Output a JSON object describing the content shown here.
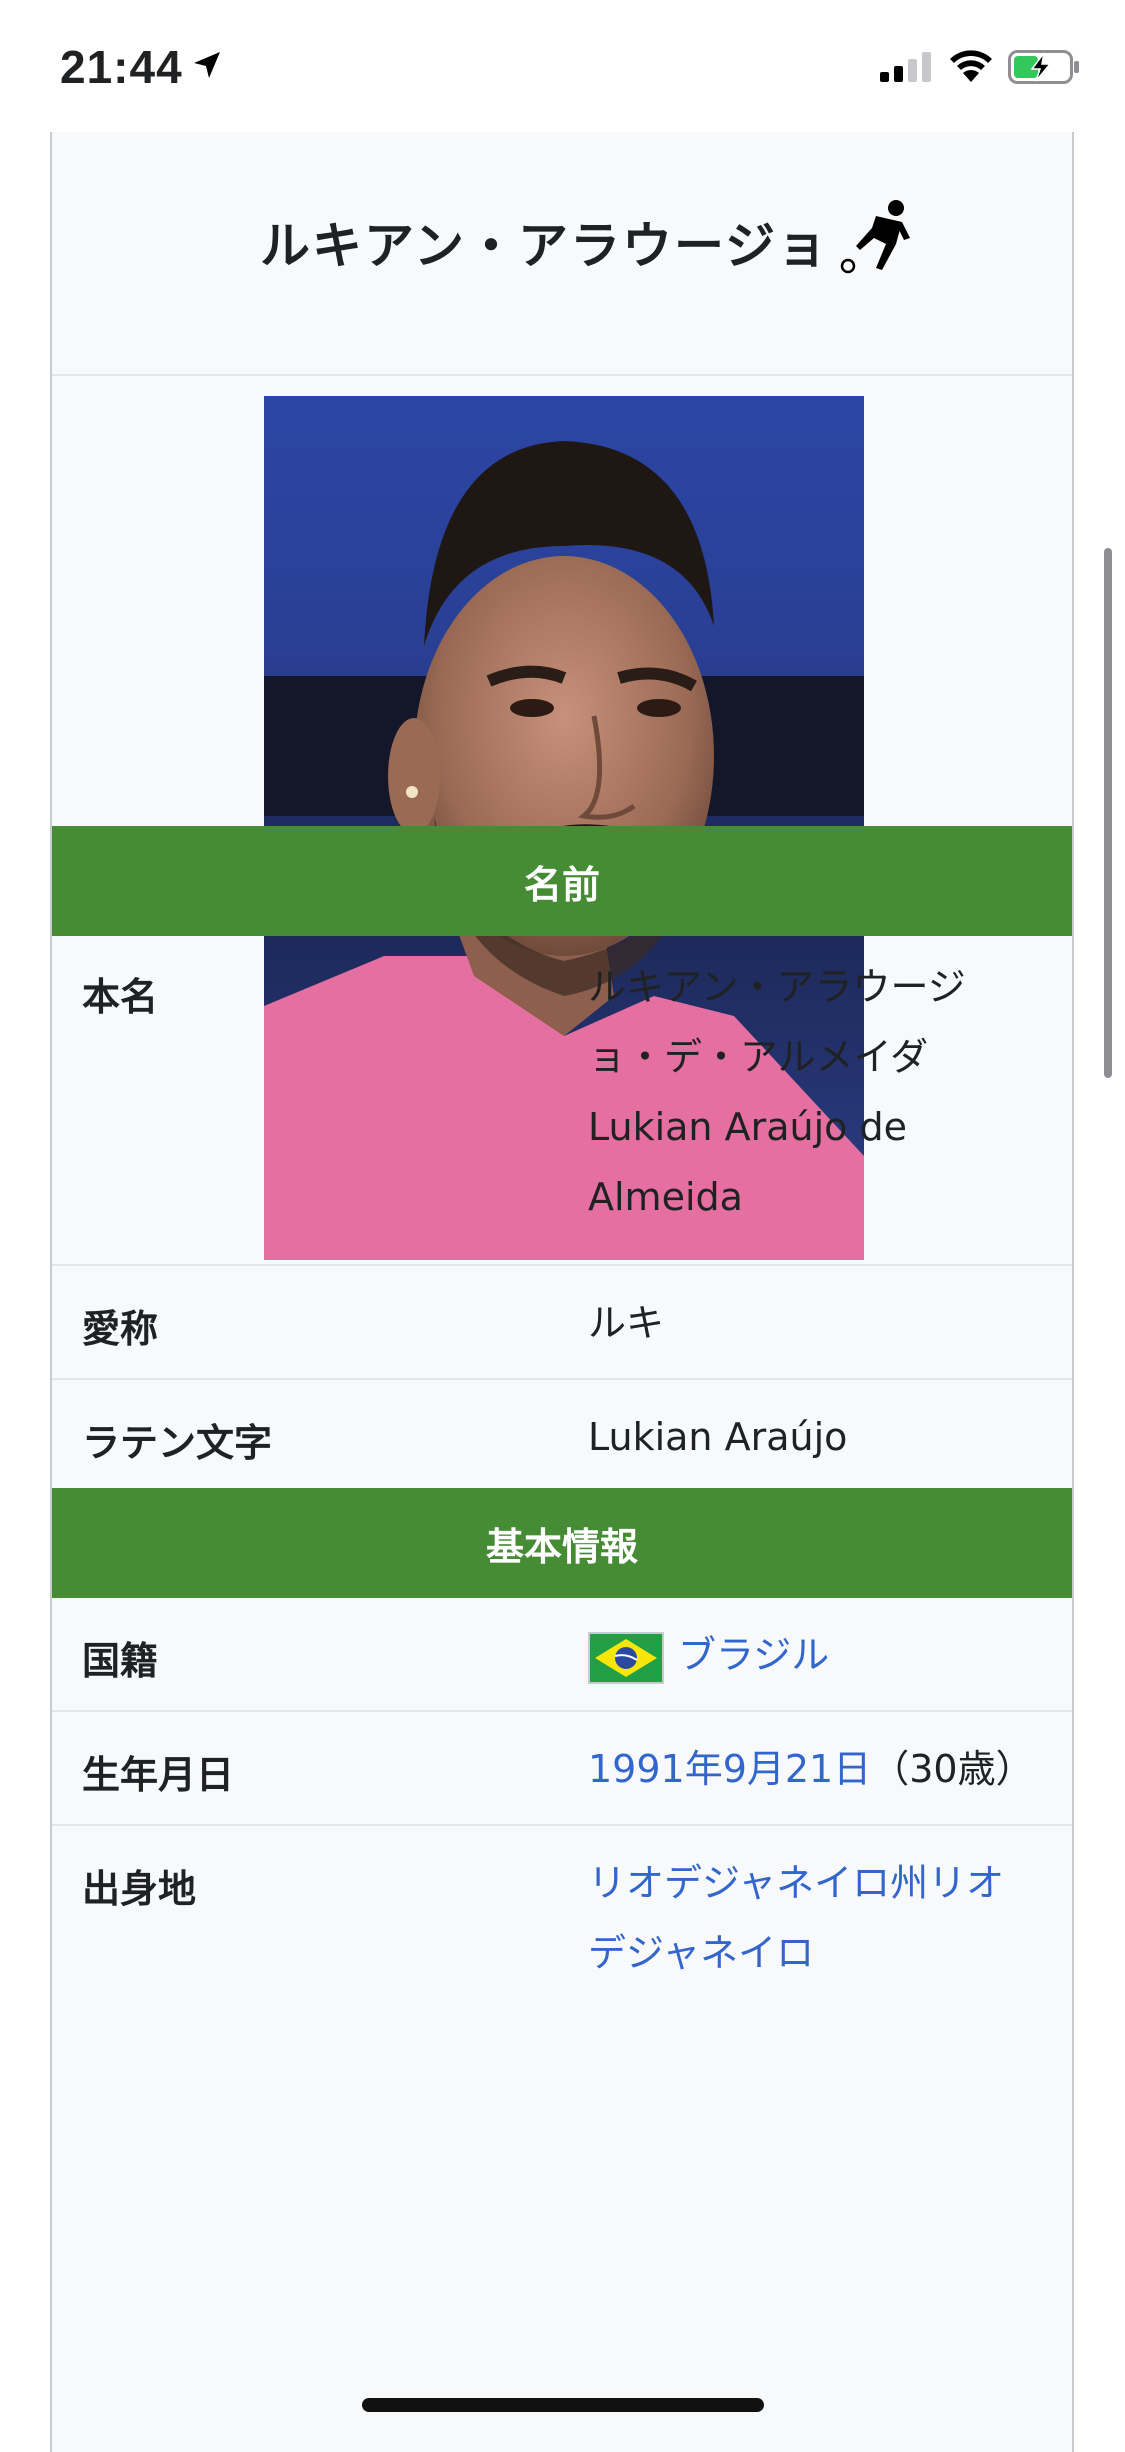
{
  "status_bar": {
    "time": "21:44",
    "location_icon": "location-arrow-icon",
    "signal_icon": "cellular-signal-icon",
    "wifi_icon": "wifi-icon",
    "battery_icon": "battery-charging-icon"
  },
  "infobox": {
    "title": "ルキアン・アラウージョ",
    "sport_icon": "football-player-icon",
    "photo": "player-photo",
    "sections": {
      "name": {
        "header": "名前",
        "rows": [
          {
            "label": "本名",
            "value_lines": [
              "ルキアン・アラウージ",
              "ョ・デ・アルメイダ",
              "Lukian Araújo de",
              "Almeida"
            ]
          },
          {
            "label": "愛称",
            "value": "ルキ"
          },
          {
            "label": "ラテン文字",
            "value": "Lukian Araújo"
          }
        ]
      },
      "basic": {
        "header": "基本情報",
        "rows": [
          {
            "label": "国籍",
            "value_link": "ブラジル",
            "flag": "brazil-flag"
          },
          {
            "label": "生年月日",
            "value_link": "1991年9月21日",
            "value_suffix": "（30歳）"
          },
          {
            "label": "出身地",
            "value_link_lines": [
              "リオデジャネイロ州リオ",
              "デジャネイロ"
            ]
          }
        ]
      }
    }
  },
  "colors": {
    "section_header_bg": "#468c34",
    "link": "#3366cc",
    "infobox_bg": "#f8f9fa"
  }
}
